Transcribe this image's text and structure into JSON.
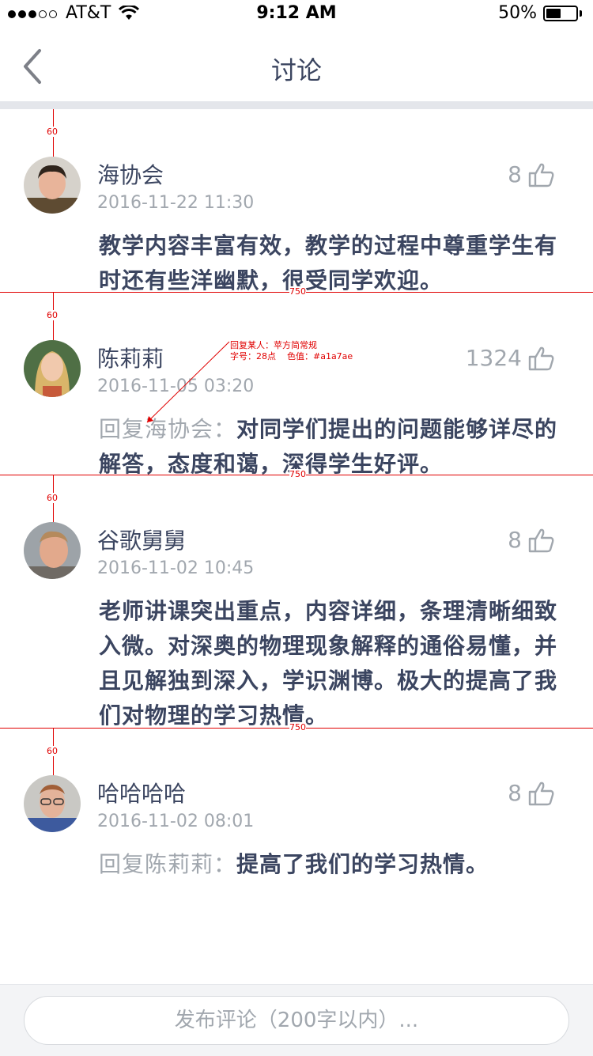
{
  "status": {
    "carrier": "AT&T",
    "time": "9:12 AM",
    "battery_text": "50%",
    "battery_level": 0.5
  },
  "nav": {
    "title": "讨论"
  },
  "annotations": {
    "spacing_label": "60",
    "width_label": "750",
    "note_line1": "回复某人：苹方简常规",
    "note_line2": "字号：28点    色值：#a1a7ae"
  },
  "comments": [
    {
      "username": "海协会",
      "time": "2016-11-22 11:30",
      "likes": "8",
      "reply_to": "",
      "text": "教学内容丰富有效，教学的过程中尊重学生有时还有些洋幽默，很受同学欢迎。"
    },
    {
      "username": "陈莉莉",
      "time": "2016-11-05 03:20",
      "likes": "1324",
      "reply_to": "回复海协会：",
      "text": "对同学们提出的问题能够详尽的解答，态度和蔼，深得学生好评。"
    },
    {
      "username": "谷歌舅舅",
      "time": "2016-11-02 10:45",
      "likes": "8",
      "reply_to": "",
      "text": "老师讲课突出重点，内容详细，条理清晰细致入微。对深奥的物理现象解释的通俗易懂，并且见解独到深入，学识渊博。极大的提高了我们对物理的学习热情。"
    },
    {
      "username": "哈哈哈哈",
      "time": "2016-11-02 08:01",
      "likes": "8",
      "reply_to": "回复陈莉莉：",
      "text": "提高了我们的学习热情。"
    }
  ],
  "composer": {
    "placeholder": "发布评论（200字以内）..."
  }
}
